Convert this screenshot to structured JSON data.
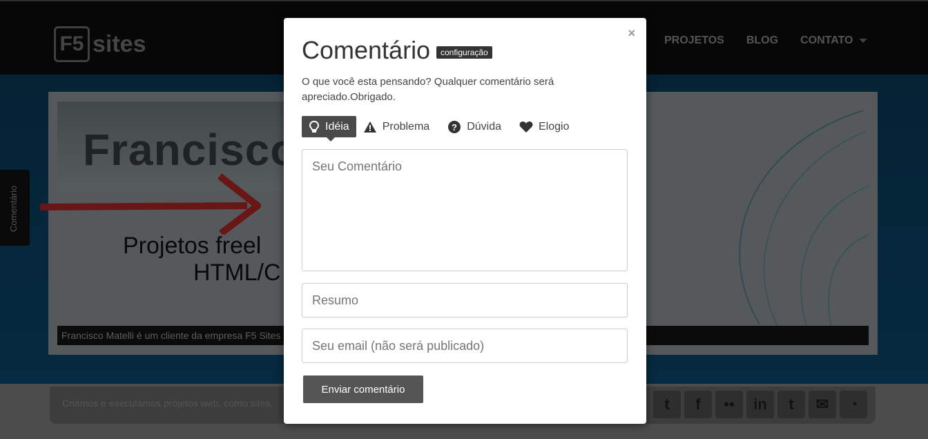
{
  "site": {
    "logo_mark": "F5",
    "logo_text": "sites",
    "nav": [
      "PROJETOS",
      "BLOG",
      "CONTATO"
    ],
    "slide_word": "Francisco",
    "slide_title_line1": "Projetos freel",
    "slide_title_line2": "HTML/C",
    "caption": "Francisco Matelli é um cliente da empresa F5 Sites",
    "side_tab": "Comentário",
    "footer_text": "Criamos e executamos projetos web, como sites,",
    "social": [
      "twitter-icon",
      "facebook-icon",
      "flickr-icon",
      "linkedin-icon",
      "tumblr-icon",
      "email-icon",
      "rss-icon"
    ]
  },
  "modal": {
    "close": "×",
    "title": "Comentário",
    "badge": "configuração",
    "description": "O que você esta pensando? Qualquer comentário será apreciado.Obrigado.",
    "tabs": [
      {
        "label": "Idéia",
        "icon": "lightbulb-icon",
        "active": true
      },
      {
        "label": "Problema",
        "icon": "warning-icon",
        "active": false
      },
      {
        "label": "Dúvida",
        "icon": "question-icon",
        "active": false
      },
      {
        "label": "Elogio",
        "icon": "heart-icon",
        "active": false
      }
    ],
    "comment_placeholder": "Seu Comentário",
    "summary_placeholder": "Resumo",
    "email_placeholder": "Seu email (não será publicado)",
    "submit": "Enviar comentário"
  }
}
